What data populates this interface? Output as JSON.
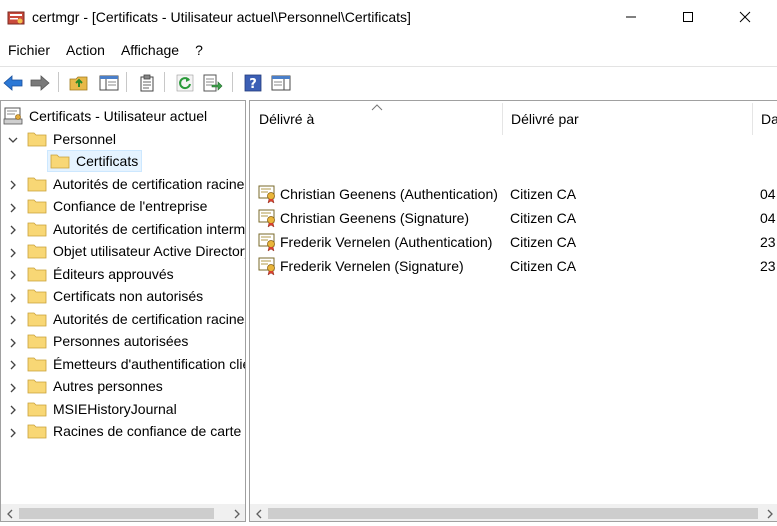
{
  "window": {
    "title": "certmgr - [Certificats - Utilisateur actuel\\Personnel\\Certificats]",
    "minimize": "—",
    "maximize": "☐",
    "close": "✕"
  },
  "menu": [
    "Fichier",
    "Action",
    "Affichage",
    "?"
  ],
  "toolbar": {
    "icons": [
      "back-arrow-icon",
      "forward-arrow-icon",
      "up-folder-icon",
      "show-hide-tree-icon",
      "clipboard-icon",
      "refresh-icon",
      "export-list-icon",
      "help-icon",
      "properties-pane-icon"
    ]
  },
  "tree": {
    "root": "Certificats - Utilisateur actuel",
    "personnel": "Personnel",
    "certificats": "Certificats",
    "items": [
      "Autorités de certification racine de confiance",
      "Confiance de l'entreprise",
      "Autorités de certification intermédiaires",
      "Objet utilisateur Active Directory",
      "Éditeurs approuvés",
      "Certificats non autorisés",
      "Autorités de certification racines tierces",
      "Personnes autorisées",
      "Émetteurs d'authentification client",
      "Autres personnes",
      "MSIEHistoryJournal",
      "Racines de confiance de carte à puce"
    ]
  },
  "list": {
    "headers": [
      "Délivré à",
      "Délivré par",
      "Date d'expiration"
    ],
    "rows": [
      {
        "issued_to": "Christian Geenens (Authentication)",
        "issued_by": "Citizen CA",
        "expires": "04"
      },
      {
        "issued_to": "Christian Geenens (Signature)",
        "issued_by": "Citizen CA",
        "expires": "04"
      },
      {
        "issued_to": "Frederik Vernelen (Authentication)",
        "issued_by": "Citizen CA",
        "expires": "23"
      },
      {
        "issued_to": "Frederik Vernelen (Signature)",
        "issued_by": "Citizen CA",
        "expires": "23"
      }
    ]
  },
  "colors": {
    "selection": "#e5f3ff",
    "folder": "#f8d775",
    "pane_border": "#a0a0a0"
  }
}
